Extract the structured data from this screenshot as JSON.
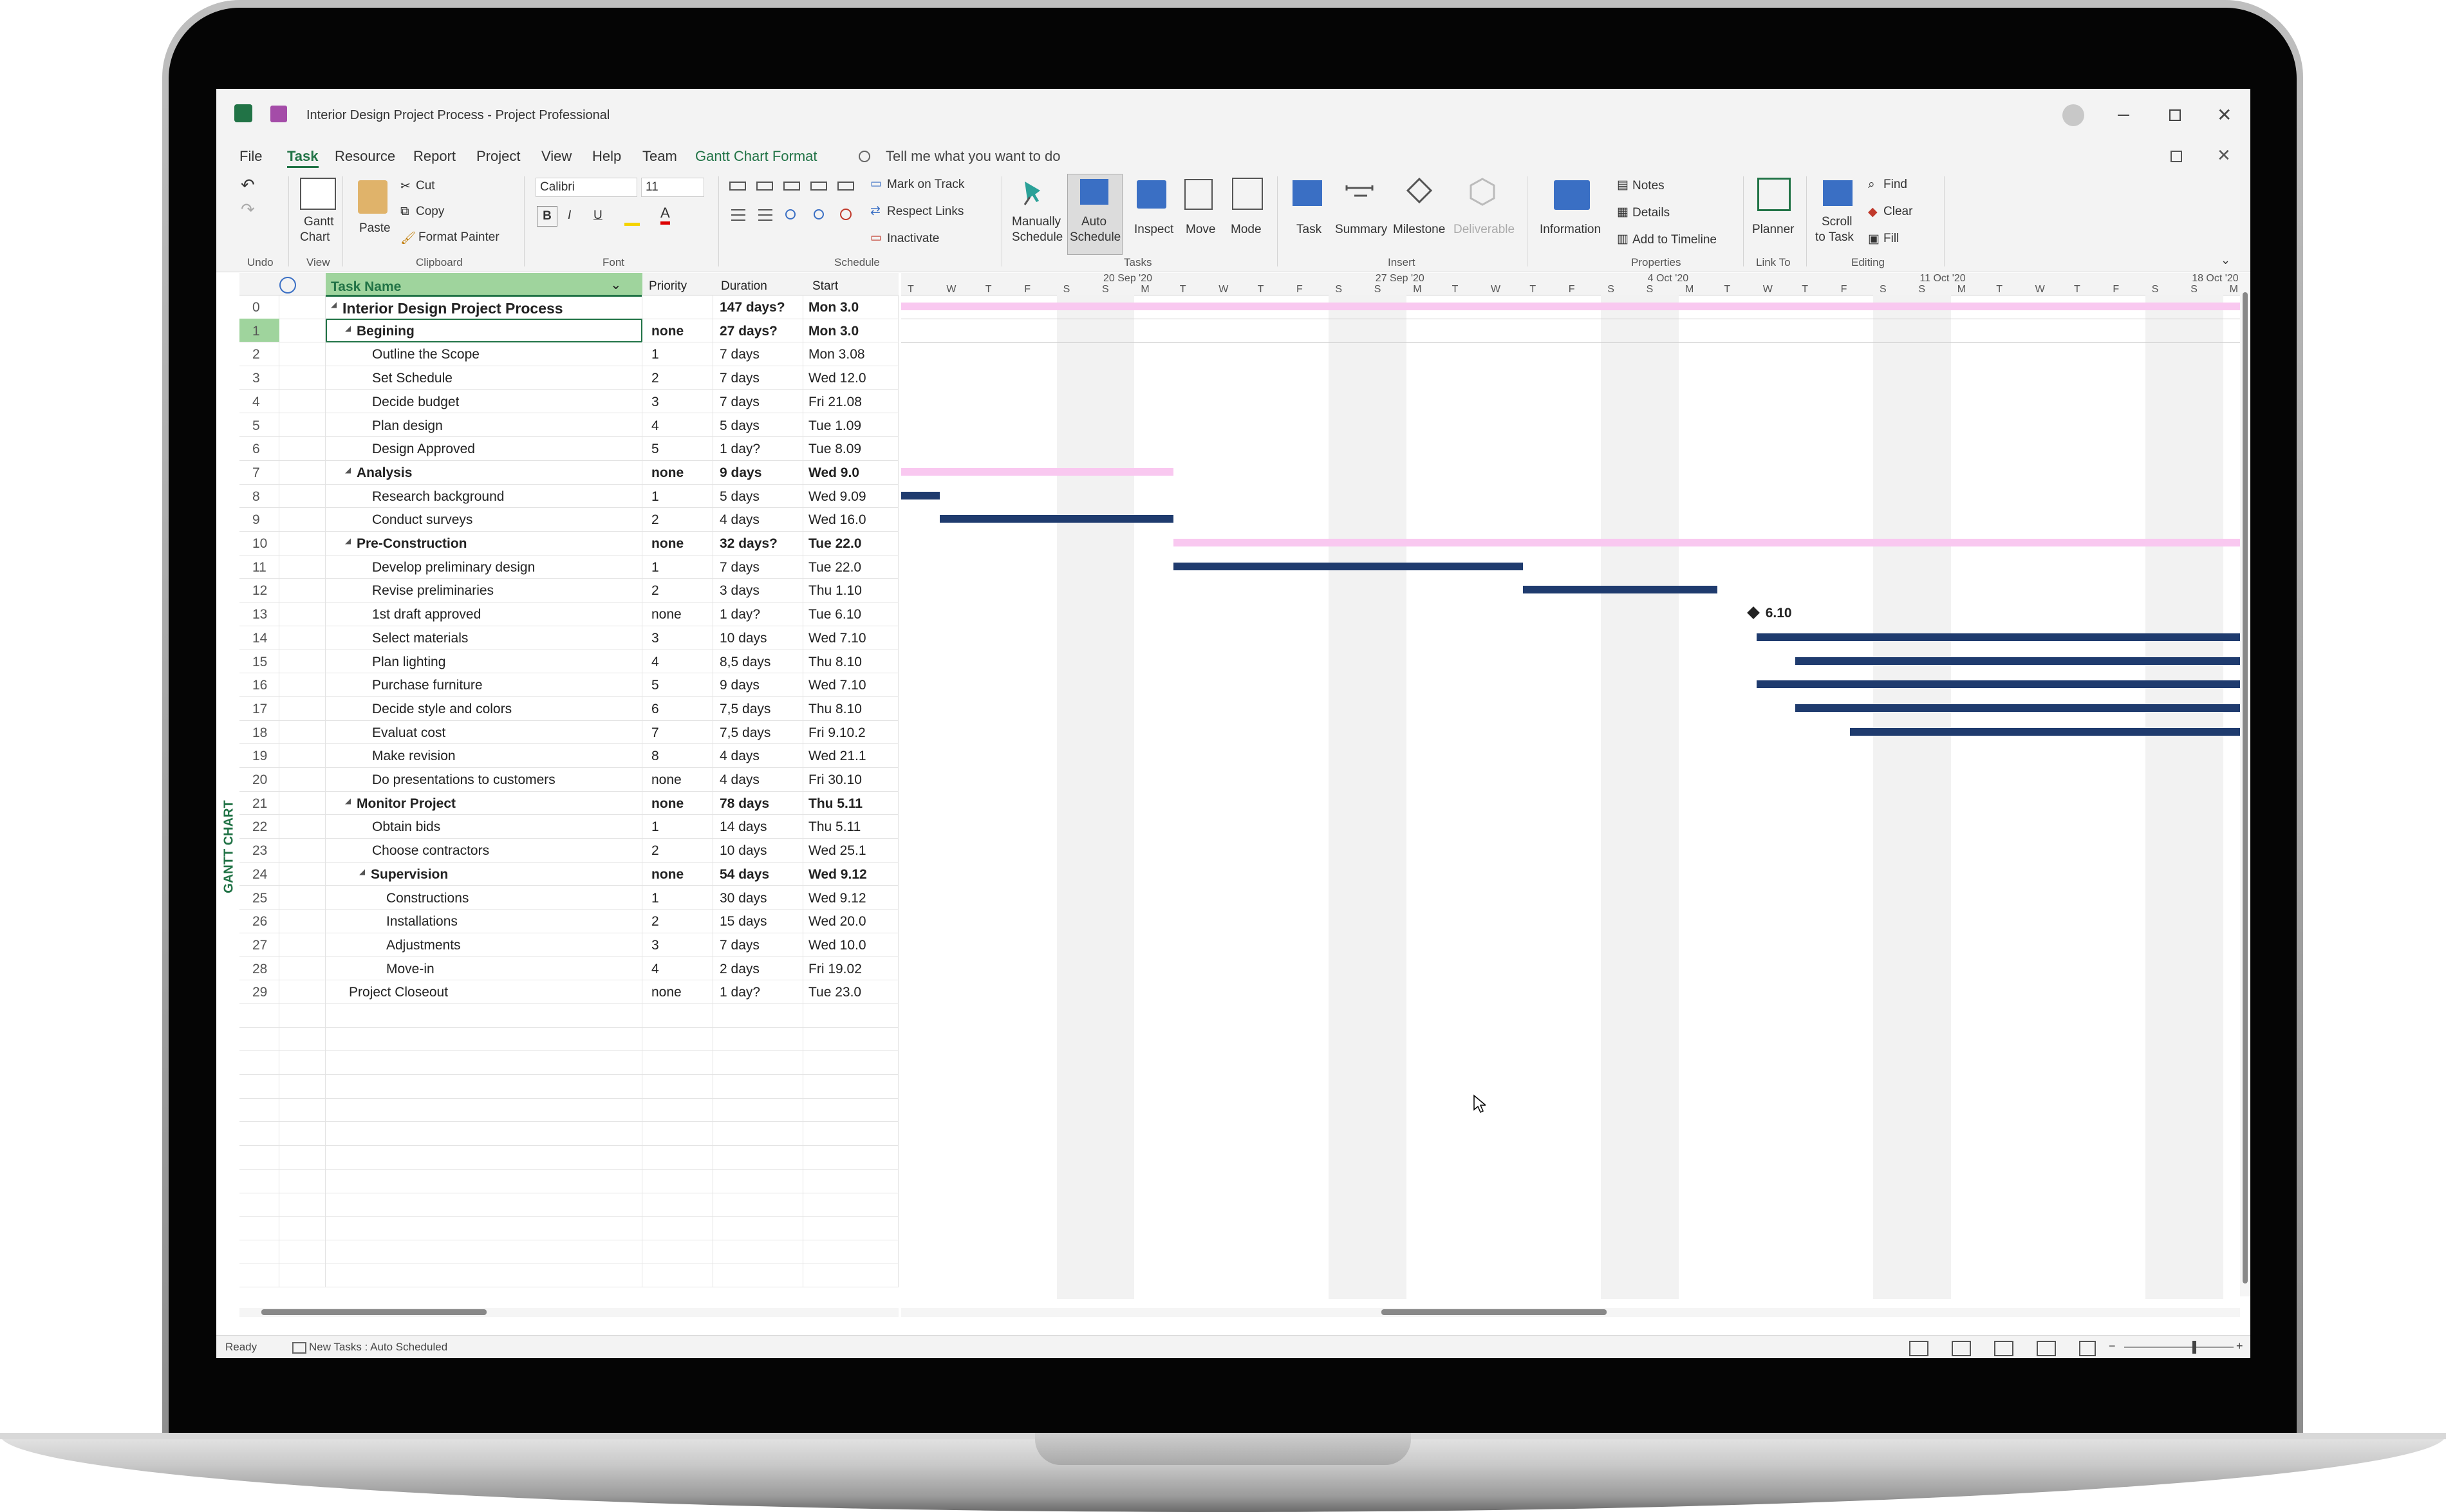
{
  "window": {
    "title": "Interior Design Project Process",
    "app_name": "Project Professional",
    "title_separator": "-"
  },
  "menu": {
    "items": [
      "File",
      "Task",
      "Resource",
      "Report",
      "Project",
      "View",
      "Help",
      "Team",
      "Gantt Chart Format"
    ],
    "active": "Task",
    "tell_me": "Tell me what you want to do"
  },
  "ribbon": {
    "undo_group": "Undo",
    "view": {
      "gantt": "Gantt",
      "gantt2": "Chart",
      "group": "View"
    },
    "clipboard": {
      "paste": "Paste",
      "cut": "Cut",
      "copy": "Copy",
      "format_painter": "Format Painter",
      "group": "Clipboard"
    },
    "font": {
      "name": "Calibri",
      "size": "11",
      "bold": "B",
      "italic": "I",
      "underline": "U",
      "color": "A",
      "group": "Font"
    },
    "schedule": {
      "mark_on_track": "Mark on Track",
      "respect_links": "Respect Links",
      "inactivate": "Inactivate",
      "group": "Schedule"
    },
    "tasks": {
      "manually1": "Manually",
      "manually2": "Schedule",
      "auto1": "Auto",
      "auto2": "Schedule",
      "inspect": "Inspect",
      "move": "Move",
      "mode": "Mode",
      "group": "Tasks"
    },
    "insert": {
      "task": "Task",
      "summary": "Summary",
      "milestone": "Milestone",
      "deliverable": "Deliverable",
      "group": "Insert"
    },
    "properties": {
      "information": "Information",
      "notes": "Notes",
      "details": "Details",
      "add_timeline": "Add to Timeline",
      "group": "Properties"
    },
    "link_to": {
      "planner": "Planner",
      "group": "Link To"
    },
    "editing": {
      "scroll1": "Scroll",
      "scroll2": "to Task",
      "find": "Find",
      "clear": "Clear",
      "fill": "Fill",
      "group": "Editing"
    }
  },
  "table": {
    "columns": {
      "task_name": "Task Name",
      "priority": "Priority",
      "duration": "Duration",
      "start": "Start"
    },
    "side_label": "GANTT CHART",
    "rows": [
      {
        "id": "0",
        "name": "Interior Design Project Process",
        "priority": "",
        "duration": "147 days?",
        "start": "Mon 3.0",
        "level": 0,
        "summary": true
      },
      {
        "id": "1",
        "name": "Begining",
        "priority": "none",
        "duration": "27 days?",
        "start": "Mon 3.0",
        "level": 1,
        "summary": true
      },
      {
        "id": "2",
        "name": "Outline the Scope",
        "priority": "1",
        "duration": "7 days",
        "start": "Mon 3.08",
        "level": 2,
        "summary": false
      },
      {
        "id": "3",
        "name": "Set Schedule",
        "priority": "2",
        "duration": "7 days",
        "start": "Wed 12.0",
        "level": 2,
        "summary": false
      },
      {
        "id": "4",
        "name": "Decide budget",
        "priority": "3",
        "duration": "7 days",
        "start": "Fri 21.08",
        "level": 2,
        "summary": false
      },
      {
        "id": "5",
        "name": "Plan design",
        "priority": "4",
        "duration": "5 days",
        "start": "Tue 1.09",
        "level": 2,
        "summary": false
      },
      {
        "id": "6",
        "name": "Design Approved",
        "priority": "5",
        "duration": "1 day?",
        "start": "Tue 8.09",
        "level": 2,
        "summary": false
      },
      {
        "id": "7",
        "name": "Analysis",
        "priority": "none",
        "duration": "9 days",
        "start": "Wed 9.0",
        "level": 1,
        "summary": true
      },
      {
        "id": "8",
        "name": "Research background",
        "priority": "1",
        "duration": "5 days",
        "start": "Wed 9.09",
        "level": 2,
        "summary": false
      },
      {
        "id": "9",
        "name": "Conduct surveys",
        "priority": "2",
        "duration": "4 days",
        "start": "Wed 16.0",
        "level": 2,
        "summary": false
      },
      {
        "id": "10",
        "name": "Pre-Construction",
        "priority": "none",
        "duration": "32 days?",
        "start": "Tue 22.0",
        "level": 1,
        "summary": true
      },
      {
        "id": "11",
        "name": "Develop preliminary design",
        "priority": "1",
        "duration": "7 days",
        "start": "Tue 22.0",
        "level": 2,
        "summary": false
      },
      {
        "id": "12",
        "name": "Revise preliminaries",
        "priority": "2",
        "duration": "3 days",
        "start": "Thu 1.10",
        "level": 2,
        "summary": false
      },
      {
        "id": "13",
        "name": "1st draft approved",
        "priority": "none",
        "duration": "1 day?",
        "start": "Tue 6.10",
        "level": 2,
        "summary": false
      },
      {
        "id": "14",
        "name": "Select materials",
        "priority": "3",
        "duration": "10 days",
        "start": "Wed 7.10",
        "level": 2,
        "summary": false
      },
      {
        "id": "15",
        "name": "Plan lighting",
        "priority": "4",
        "duration": "8,5 days",
        "start": "Thu 8.10",
        "level": 2,
        "summary": false
      },
      {
        "id": "16",
        "name": "Purchase furniture",
        "priority": "5",
        "duration": "9 days",
        "start": "Wed 7.10",
        "level": 2,
        "summary": false
      },
      {
        "id": "17",
        "name": "Decide style and colors",
        "priority": "6",
        "duration": "7,5 days",
        "start": "Thu 8.10",
        "level": 2,
        "summary": false
      },
      {
        "id": "18",
        "name": "Evaluat cost",
        "priority": "7",
        "duration": "7,5 days",
        "start": "Fri 9.10.2",
        "level": 2,
        "summary": false
      },
      {
        "id": "19",
        "name": "Make revision",
        "priority": "8",
        "duration": "4 days",
        "start": "Wed 21.1",
        "level": 2,
        "summary": false
      },
      {
        "id": "20",
        "name": "Do presentations to customers",
        "priority": "none",
        "duration": "4 days",
        "start": "Fri 30.10",
        "level": 2,
        "summary": false
      },
      {
        "id": "21",
        "name": "Monitor Project",
        "priority": "none",
        "duration": "78 days",
        "start": "Thu 5.11",
        "level": 1,
        "summary": true
      },
      {
        "id": "22",
        "name": "Obtain bids",
        "priority": "1",
        "duration": "14 days",
        "start": "Thu 5.11",
        "level": 2,
        "summary": false
      },
      {
        "id": "23",
        "name": "Choose contractors",
        "priority": "2",
        "duration": "10 days",
        "start": "Wed 25.1",
        "level": 2,
        "summary": false
      },
      {
        "id": "24",
        "name": "Supervision",
        "priority": "none",
        "duration": "54 days",
        "start": "Wed 9.12",
        "level": 2,
        "summary": true
      },
      {
        "id": "25",
        "name": "Constructions",
        "priority": "1",
        "duration": "30 days",
        "start": "Wed 9.12",
        "level": 3,
        "summary": false
      },
      {
        "id": "26",
        "name": "Installations",
        "priority": "2",
        "duration": "15 days",
        "start": "Wed 20.0",
        "level": 3,
        "summary": false
      },
      {
        "id": "27",
        "name": "Adjustments",
        "priority": "3",
        "duration": "7 days",
        "start": "Wed 10.0",
        "level": 3,
        "summary": false
      },
      {
        "id": "28",
        "name": "Move-in",
        "priority": "4",
        "duration": "2 days",
        "start": "Fri 19.02",
        "level": 3,
        "summary": false
      },
      {
        "id": "29",
        "name": "Project Closeout",
        "priority": "none",
        "duration": "1 day?",
        "start": "Tue 23.0",
        "level": 1,
        "summary": false
      }
    ]
  },
  "timescale": {
    "weeks": [
      "20 Sep '20",
      "27 Sep '20",
      "4 Oct '20",
      "11 Oct '20",
      "18 Oct '20"
    ],
    "days": [
      "T",
      "W",
      "T",
      "F",
      "S",
      "S",
      "M",
      "T",
      "W",
      "T",
      "F",
      "S",
      "S",
      "M",
      "T",
      "W",
      "T",
      "F",
      "S",
      "S",
      "M",
      "T",
      "W",
      "T",
      "F",
      "S",
      "S",
      "M",
      "T",
      "W",
      "T",
      "F",
      "S",
      "S",
      "M",
      "T"
    ],
    "milestone_label": "6.10"
  },
  "gantt": {
    "start_date": "2020-09-15",
    "summary_bars": [
      {
        "row": 0,
        "from": 0,
        "to": 36
      },
      {
        "row": 7,
        "from": 0,
        "to": 7
      },
      {
        "row": 10,
        "from": 7,
        "to": 36
      }
    ],
    "task_bars": [
      {
        "row": 8,
        "from": 0,
        "to": 1
      },
      {
        "row": 9,
        "from": 1,
        "to": 7
      },
      {
        "row": 11,
        "from": 7,
        "to": 16
      },
      {
        "row": 12,
        "from": 16,
        "to": 21
      },
      {
        "row": 14,
        "from": 22,
        "to": 36
      },
      {
        "row": 15,
        "from": 23,
        "to": 35.5
      },
      {
        "row": 16,
        "from": 22,
        "to": 35
      },
      {
        "row": 17,
        "from": 23,
        "to": 34.5
      },
      {
        "row": 18,
        "from": 24.4,
        "to": 36
      }
    ],
    "milestone_row": 13,
    "milestone_day": 21.8
  },
  "status": {
    "ready": "Ready",
    "new_tasks": "New Tasks : Auto Scheduled"
  }
}
